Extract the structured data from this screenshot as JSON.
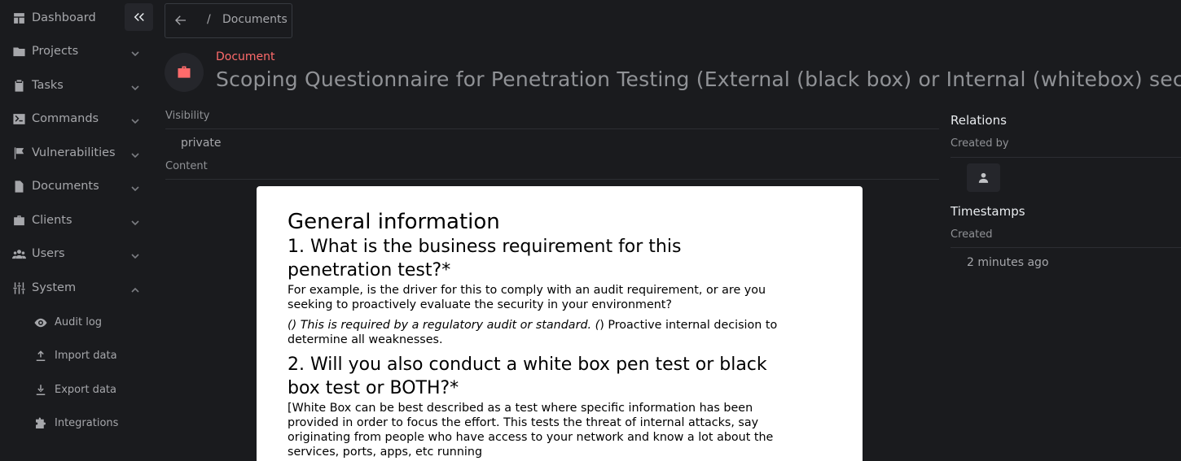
{
  "sidebar": {
    "items": [
      {
        "label": "Dashboard",
        "icon": "dashboard-icon"
      },
      {
        "label": "Projects",
        "icon": "folder-icon"
      },
      {
        "label": "Tasks",
        "icon": "clipboard-icon"
      },
      {
        "label": "Commands",
        "icon": "terminal-icon"
      },
      {
        "label": "Vulnerabilities",
        "icon": "flag-icon"
      },
      {
        "label": "Documents",
        "icon": "document-icon"
      },
      {
        "label": "Clients",
        "icon": "briefcase-icon"
      },
      {
        "label": "Users",
        "icon": "users-icon"
      },
      {
        "label": "System",
        "icon": "sliders-icon"
      }
    ],
    "system_subitems": [
      {
        "label": "Audit log",
        "icon": "eye-icon"
      },
      {
        "label": "Import data",
        "icon": "upload-icon"
      },
      {
        "label": "Export data",
        "icon": "download-icon"
      },
      {
        "label": "Integrations",
        "icon": "puzzle-icon"
      }
    ]
  },
  "breadcrumb": {
    "separator": "/",
    "current": "Documents"
  },
  "header": {
    "kind": "Document",
    "title": "Scoping Questionnaire for Penetration Testing (External (black box) or Internal (whitebox) security assessment)"
  },
  "fields": {
    "visibility_label": "Visibility",
    "visibility_value": "private",
    "content_label": "Content"
  },
  "content": {
    "h1": "General information",
    "q1_line1": "1. What is the business requirement for this",
    "q1_line2": "penetration test?*",
    "q1_p1_line1": "For example, is the driver for this to comply with an audit requirement, or are you",
    "q1_p1_line2": "seeking to proactively evaluate the security in your environment?",
    "q1_p2_italic": "() This is required by a regulatory audit or standard. (",
    "q1_p2_rest": ") Proactive internal decision to",
    "q1_p2_line2": "determine all weaknesses.",
    "q2_line1": "2. Will you also conduct a white box pen test or black",
    "q2_line2": "box test or BOTH?*",
    "q2_p_line1": "[White Box can be best described as a test where specific information has been",
    "q2_p_line2": "provided in order to focus the effort. This tests the threat of internal attacks, say",
    "q2_p_line3": "originating from people who have access to your network and know a lot about the",
    "q2_p_line4": "services, ports, apps, etc running"
  },
  "right_panel": {
    "relations_title": "Relations",
    "created_by_label": "Created by",
    "timestamps_title": "Timestamps",
    "created_label": "Created",
    "created_value": "2 minutes ago"
  },
  "colors": {
    "background": "#1a1b1e",
    "accent_red": "#ff6b6b",
    "muted_text": "#a6a7ab",
    "card_bg": "#ffffff"
  }
}
